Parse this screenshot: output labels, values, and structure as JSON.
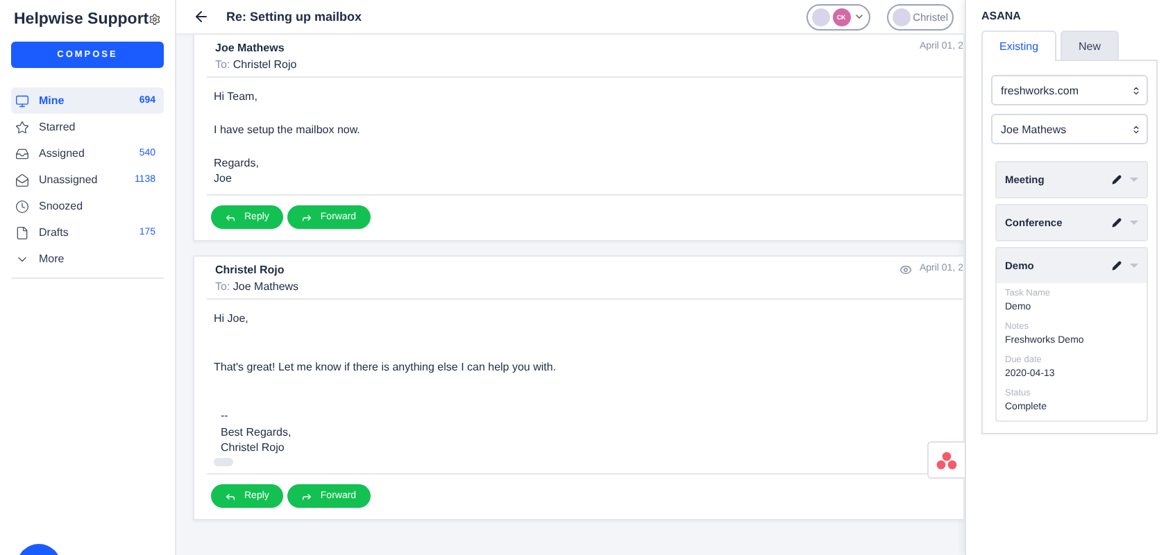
{
  "sidebar": {
    "title": "Helpwise Support",
    "compose": "COMPOSE",
    "items": [
      {
        "label": "Mine",
        "count": "694",
        "selected": true
      },
      {
        "label": "Starred",
        "selected": false
      },
      {
        "label": "Assigned",
        "count": "540",
        "selected": false
      },
      {
        "label": "Unassigned",
        "count": "1138",
        "selected": false
      },
      {
        "label": "Snoozed",
        "selected": false
      },
      {
        "label": "Drafts",
        "count": "175",
        "selected": false
      },
      {
        "label": "More",
        "selected": false
      }
    ]
  },
  "header": {
    "subject": "Re: Setting up mailbox",
    "assignee_initials": "CK",
    "assignee_name": "Christel"
  },
  "messages": [
    {
      "from": "Joe Mathews",
      "to_label": "To:",
      "to": "Christel Rojo",
      "date": "April 01, 2",
      "seen": false,
      "paragraphs": [
        "Hi Team,",
        "I have setup the mailbox now.",
        "Regards,\nJoe"
      ],
      "actions": [
        "Reply",
        "Forward"
      ]
    },
    {
      "from": "Christel Rojo",
      "to_label": "To:",
      "to": "Joe Mathews",
      "date": "April 01, 2",
      "seen": true,
      "paragraphs": [
        "Hi Joe,",
        "That's great! Let me know if there is anything else I can help you with."
      ],
      "signature": "--\nBest Regards,\nChristel Rojo",
      "actions": [
        "Reply",
        "Forward"
      ]
    }
  ],
  "panel": {
    "title": "ASANA",
    "tabs": [
      {
        "label": "Existing",
        "selected": true
      },
      {
        "label": "New",
        "selected": false
      }
    ],
    "selects": [
      "freshworks.com",
      "Joe Mathews"
    ],
    "tasks": [
      {
        "name": "Meeting",
        "expanded": false
      },
      {
        "name": "Conference",
        "expanded": false
      },
      {
        "name": "Demo",
        "expanded": true,
        "fields": [
          {
            "label": "Task Name",
            "value": "Demo"
          },
          {
            "label": "Notes",
            "value": "Freshworks Demo"
          },
          {
            "label": "Due date",
            "value": "2020-04-13"
          },
          {
            "label": "Status",
            "value": "Complete"
          }
        ]
      }
    ]
  }
}
